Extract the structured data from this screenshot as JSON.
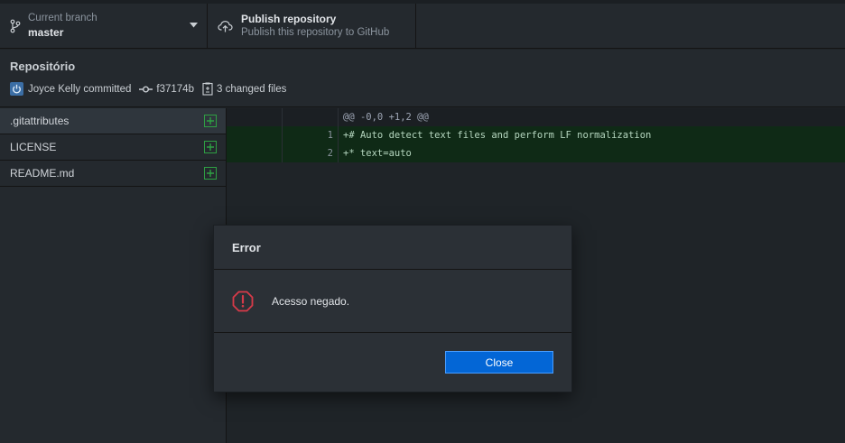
{
  "toolbar": {
    "branch_caption": "Current branch",
    "branch_name": "master",
    "publish_title": "Publish repository",
    "publish_subtitle": "Publish this repository to GitHub",
    "branch_icon": "git-branch-icon",
    "publish_icon": "cloud-upload-icon"
  },
  "commit": {
    "title": "Repositório",
    "author_text": "Joyce Kelly committed",
    "sha": "f37174b",
    "changed_files": "3 changed files"
  },
  "files": [
    {
      "name": ".gitattributes",
      "status": "added",
      "selected": true
    },
    {
      "name": "LICENSE",
      "status": "added",
      "selected": false
    },
    {
      "name": "README.md",
      "status": "added",
      "selected": false
    }
  ],
  "diff": {
    "hunk_header": "@@ -0,0 +1,2 @@",
    "lines": [
      {
        "new_line": "1",
        "text": "+# Auto detect text files and perform LF normalization"
      },
      {
        "new_line": "2",
        "text": "+* text=auto"
      }
    ]
  },
  "dialog": {
    "title": "Error",
    "message": "Acesso negado.",
    "close_label": "Close",
    "icon": "stop-alert-icon"
  },
  "colors": {
    "background": "#1f2428",
    "toolbar": "#24292e",
    "added": "#2ea043",
    "added_line_bg": "#0f2a16",
    "error_icon": "#d73a49",
    "primary_button": "#0366d6"
  }
}
